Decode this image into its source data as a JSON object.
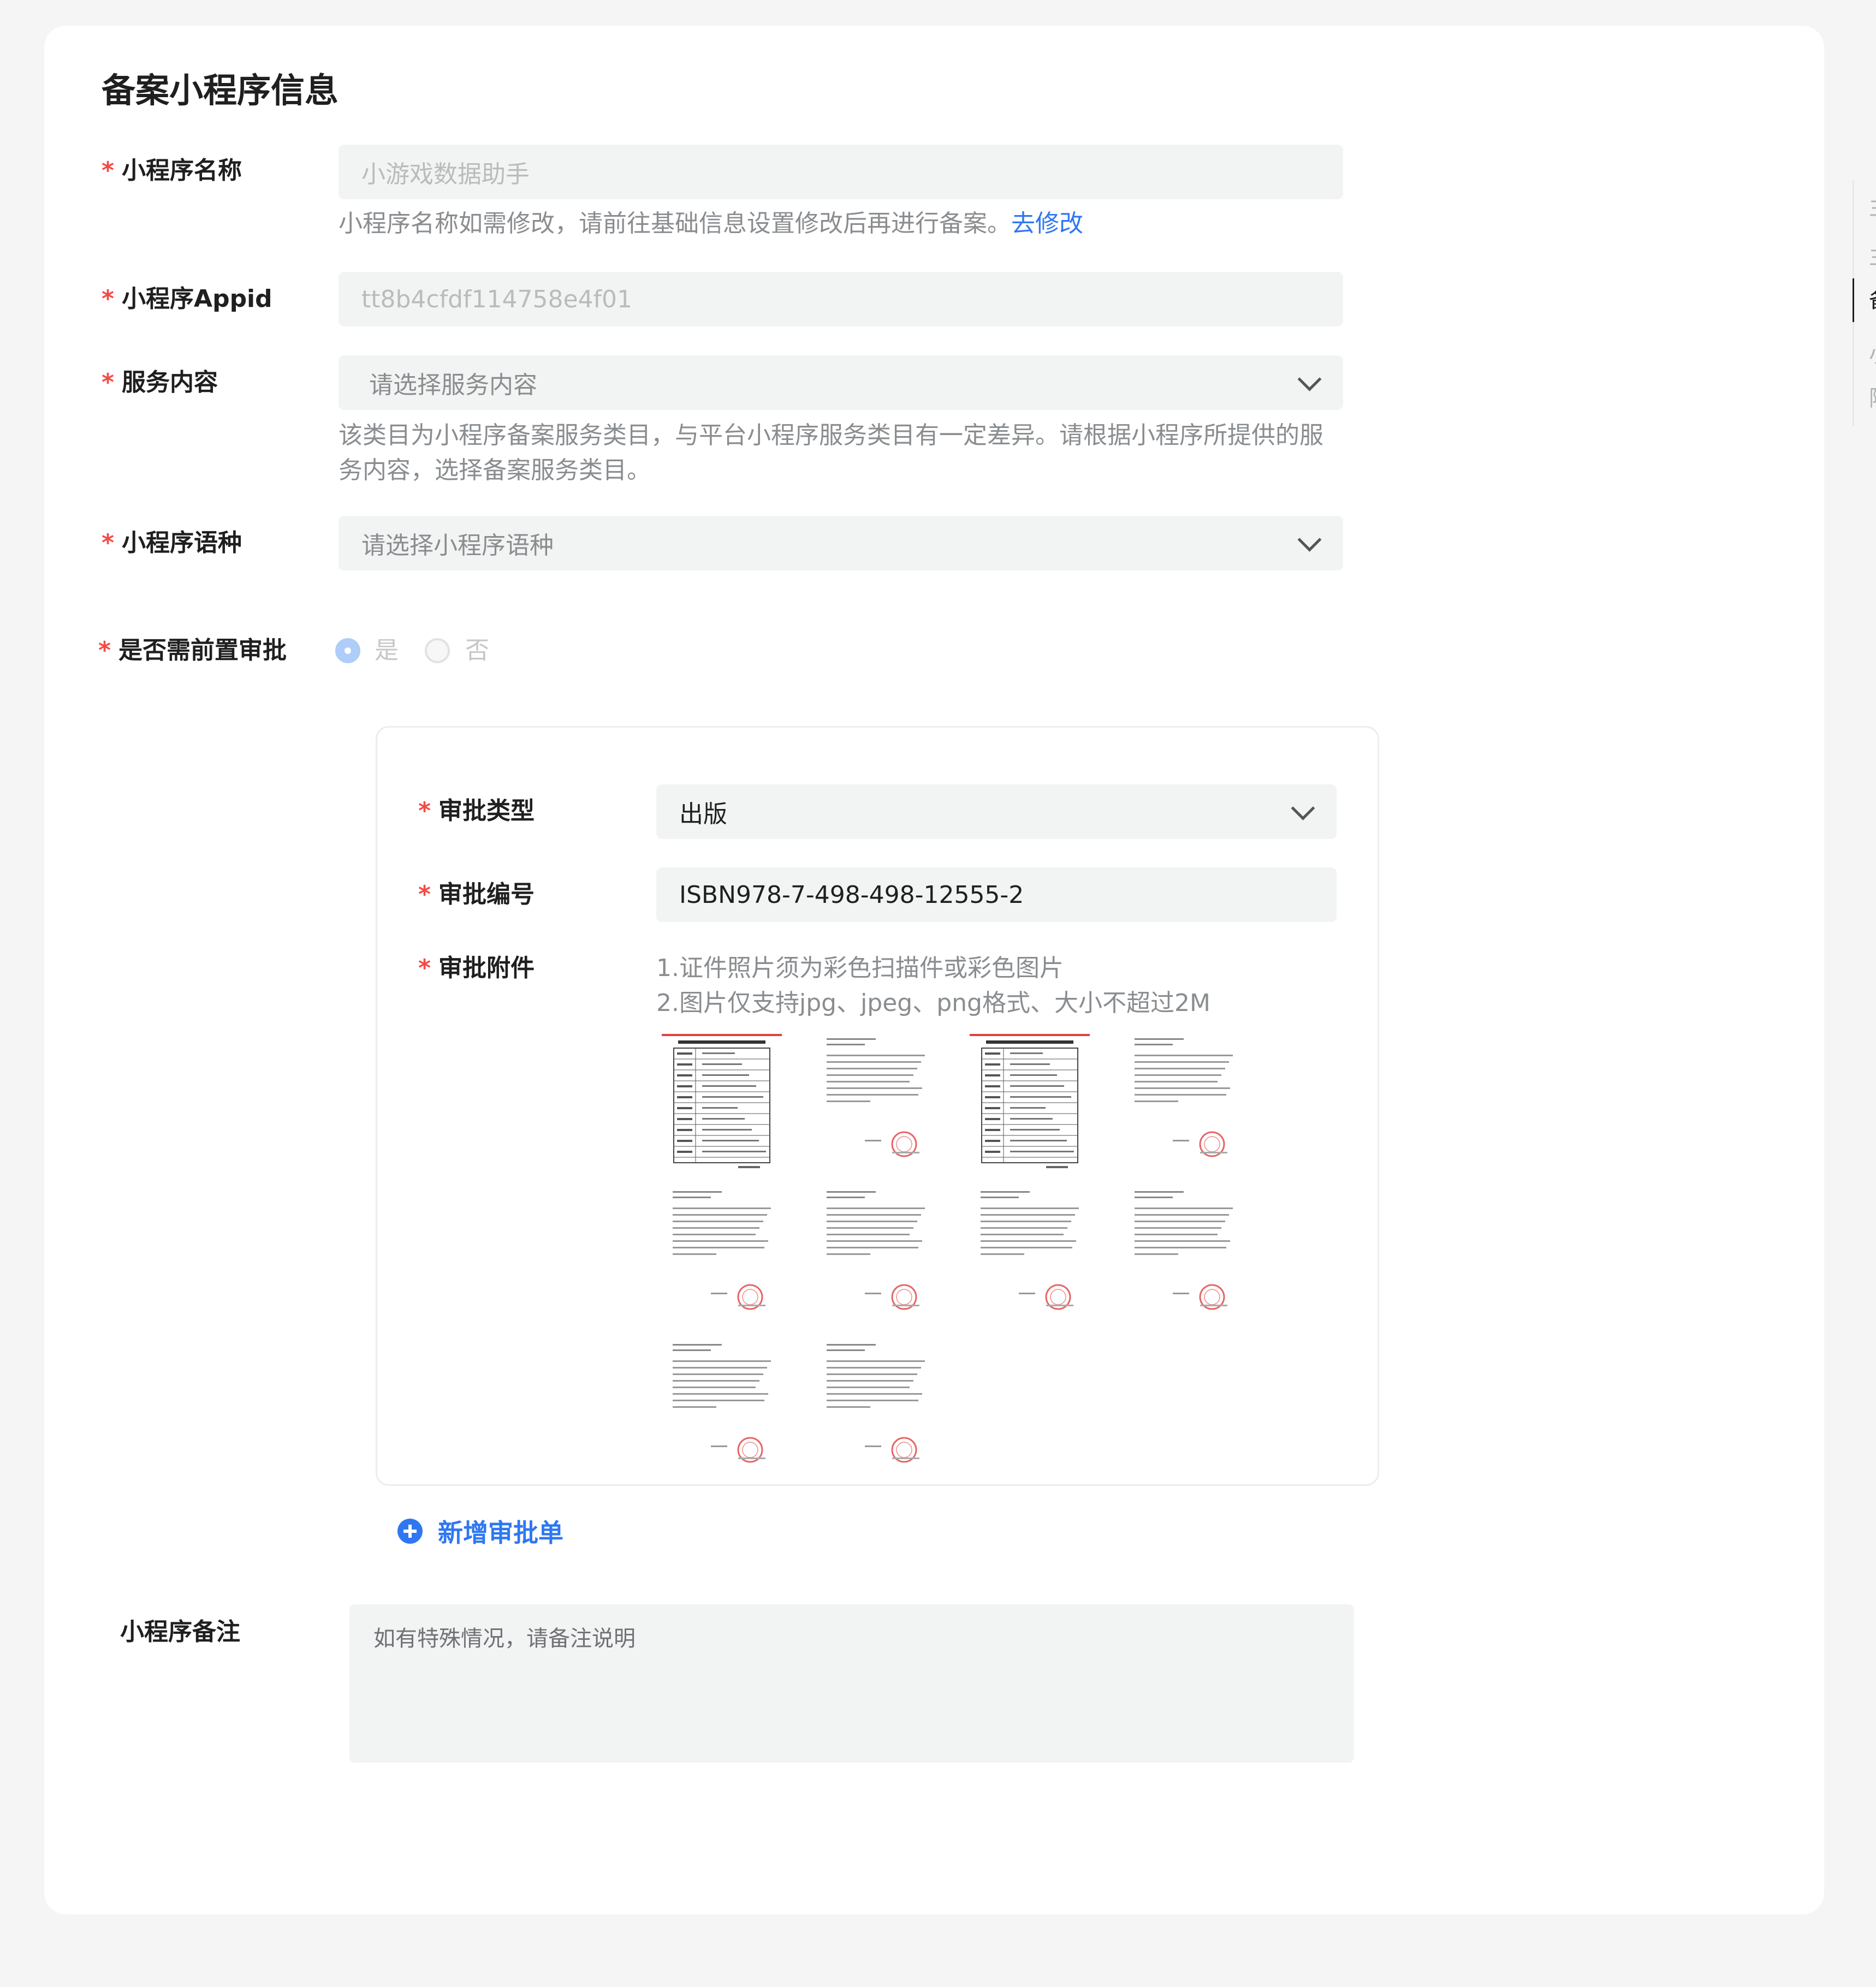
{
  "section_title": "备案小程序信息",
  "required_mark": "*",
  "fields": {
    "name": {
      "label": "小程序名称",
      "value": "小游戏数据助手",
      "hint": "小程序名称如需修改，请前往基础信息设置修改后再进行备案。",
      "hint_link": "去修改"
    },
    "appid": {
      "label": "小程序Appid",
      "value": "tt8b4cfdf114758e4f01"
    },
    "service": {
      "label": "服务内容",
      "placeholder": "请选择服务内容",
      "hint_line1": "该类目为小程序备案服务类目，与平台小程序服务类目有一定差异。请根据小程序所提供的服",
      "hint_line2": "务内容，选择备案服务类目。"
    },
    "language": {
      "label": "小程序语种",
      "placeholder": "请选择小程序语种"
    },
    "pre_approval": {
      "label": "是否需前置审批",
      "options": [
        "是",
        "否"
      ],
      "selected": "是"
    }
  },
  "approval": {
    "type_label": "审批类型",
    "type_value": "出版",
    "number_label": "审批编号",
    "number_value": "ISBN978-7-498-498-12555-2",
    "attachment_label": "审批附件",
    "attachment_hint1": "1.证件照片须为彩色扫描件或彩色图片",
    "attachment_hint2": "2.图片仅支持jpg、jpeg、png格式、大小不超过2M",
    "attachments": [
      "form-scan",
      "letter-scan",
      "form-scan",
      "letter-scan",
      "letter-scan",
      "letter-scan",
      "letter-scan",
      "letter-scan",
      "letter-scan",
      "letter-scan"
    ]
  },
  "add_approval_label": "新增审批单",
  "remark": {
    "label": "小程序备注",
    "placeholder": "如有特殊情况，请备注说明"
  },
  "anchor_nav": {
    "items": [
      "主",
      "主",
      "备",
      "小",
      "附"
    ],
    "active_index": 2
  },
  "colors": {
    "accent": "#2f77f1",
    "required": "#f54a45",
    "stamp": "#e04040"
  }
}
